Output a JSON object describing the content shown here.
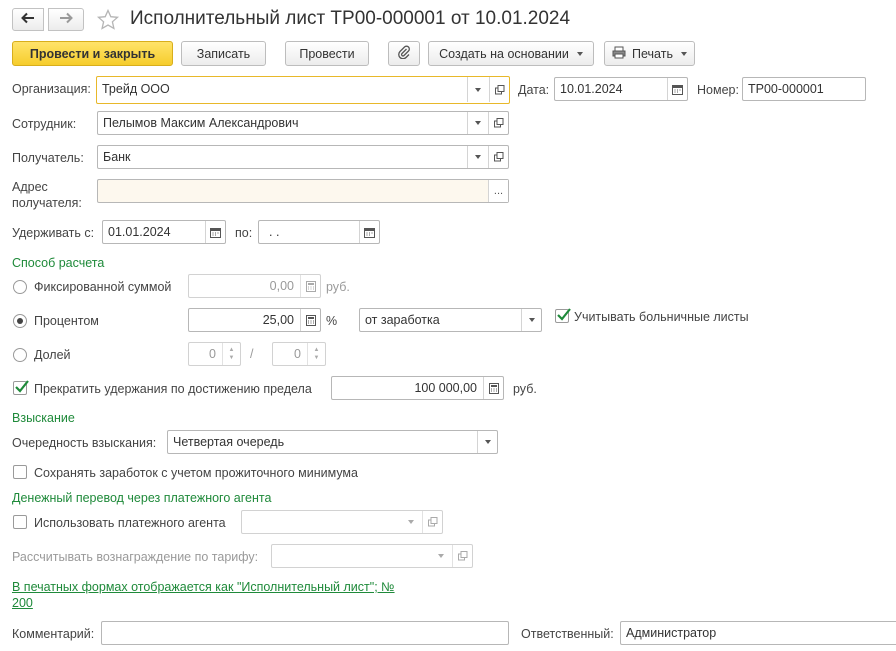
{
  "header": {
    "back_icon": "arrow-left-icon",
    "forward_icon": "arrow-right-icon",
    "star_icon": "star-icon",
    "title": "Исполнительный лист ТР00-000001 от 10.01.2024"
  },
  "toolbar": {
    "post_close": "Провести и закрыть",
    "save": "Записать",
    "post": "Провести",
    "attach_icon": "paperclip-icon",
    "create_based": "Создать на основании",
    "print": "Печать",
    "print_icon": "printer-icon"
  },
  "form": {
    "org_label": "Организация:",
    "org_value": "Трейд ООО",
    "date_label": "Дата:",
    "date_value": "10.01.2024",
    "number_label": "Номер:",
    "number_value": "ТР00-000001",
    "employee_label": "Сотрудник:",
    "employee_value": "Пелымов Максим Александрович",
    "recipient_label": "Получатель:",
    "recipient_value": "Банк",
    "address_label_1": "Адрес",
    "address_label_2": "получателя:",
    "address_value": "",
    "address_btn": "...",
    "withhold_from_label": "Удерживать с:",
    "withhold_from_value": "01.01.2024",
    "withhold_to_label": "по:",
    "withhold_to_value": " .  .",
    "calc_section": "Способ расчета",
    "fixed_label": "Фиксированной суммой",
    "fixed_value": "0,00",
    "fixed_unit": "руб.",
    "percent_label": "Процентом",
    "percent_value": "25,00",
    "percent_unit": "%",
    "percent_base": "от заработка",
    "sick_leave_label": "Учитывать больничные листы",
    "share_label": "Долей",
    "share_num": "0",
    "share_sep": "/",
    "share_den": "0",
    "limit_label": "Прекратить удержания по достижению предела",
    "limit_value": "100 000,00",
    "limit_unit": "руб.",
    "collection_section": "Взыскание",
    "priority_label": "Очередность взыскания:",
    "priority_value": "Четвертая очередь",
    "subsistence_label": "Сохранять заработок с учетом прожиточного минимума",
    "transfer_section": "Денежный перевод через платежного агента",
    "use_agent_label": "Использовать платежного агента",
    "tariff_label": "Рассчитывать вознаграждение по тарифу:",
    "print_link_1": "В печатных формах отображается как \"Исполнительный лист\"; №",
    "print_link_2": "200",
    "comment_label": "Комментарий:",
    "comment_value": "",
    "responsible_label": "Ответственный:",
    "responsible_value": "Администратор"
  },
  "state": {
    "calc_method": "percent",
    "sick_leave_checked": true,
    "limit_checked": true,
    "subsistence_checked": false,
    "use_agent_checked": false
  },
  "colors": {
    "accent_yellow": "#f6cd2c",
    "section_green": "#1f8a3a",
    "focus_border": "#e8b82a",
    "readonly_bg": "#fdf8ee"
  }
}
